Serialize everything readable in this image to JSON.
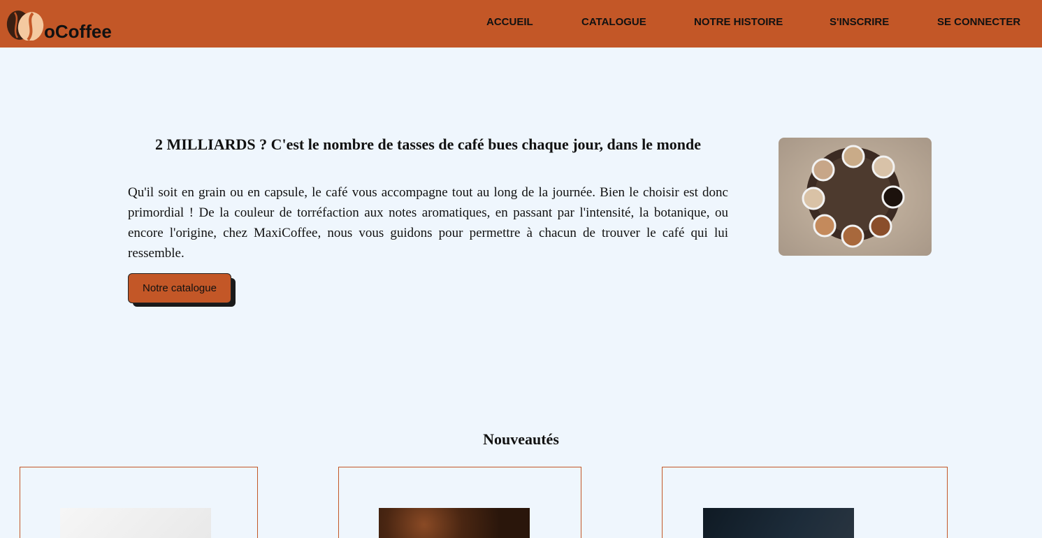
{
  "header": {
    "logo_text": "oCoffee",
    "nav": [
      "ACCUEIL",
      "CATALOGUE",
      "NOTRE HISTOIRE",
      "S'INSCRIRE",
      "SE CONNECTER"
    ]
  },
  "hero": {
    "title": "2 MILLIARDS ? C'est le nombre de tasses de café bues chaque jour, dans le monde",
    "text": "Qu'il soit en grain ou en capsule, le café vous accompagne tout au long de la journée. Bien le choisir est donc primordial ! De la couleur de torréfaction aux notes aromatiques, en passant par l'intensité, la botanique, ou encore l'origine, chez MaxiCoffee, nous vous guidons pour permettre à chacun de trouver le café qui lui ressemble.",
    "cta_label": "Notre catalogue"
  },
  "news": {
    "title": "Nouveautés"
  },
  "colors": {
    "accent": "#c35727",
    "background": "#eff6fd",
    "text": "#111111"
  }
}
